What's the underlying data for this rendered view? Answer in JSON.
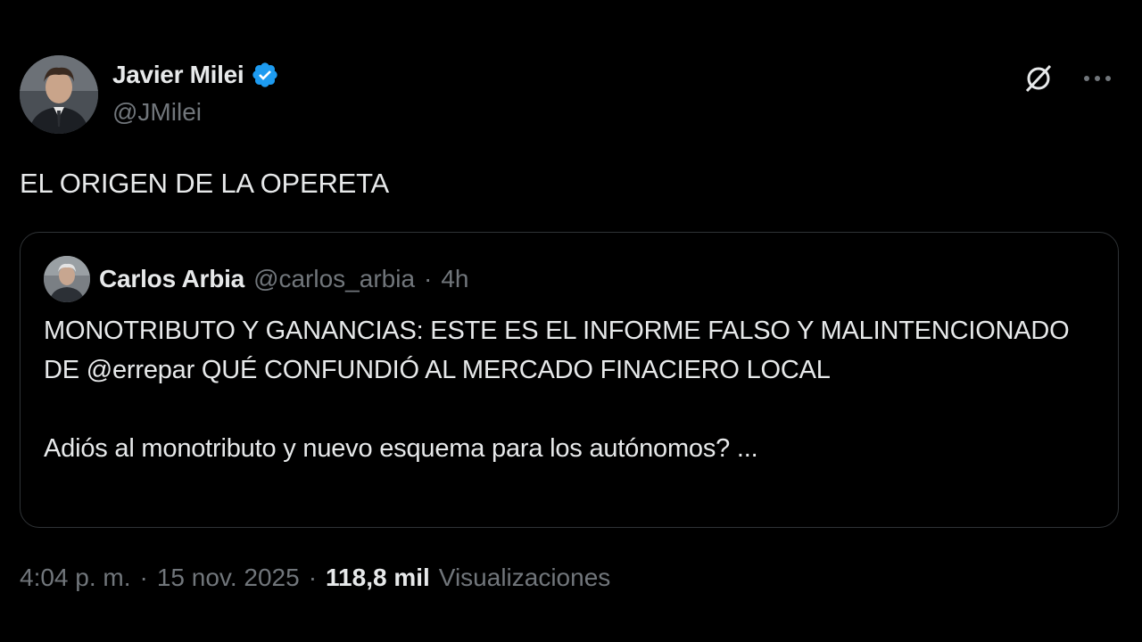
{
  "tweet": {
    "author": {
      "name": "Javier Milei",
      "handle": "@JMilei"
    },
    "text": "EL ORIGEN DE LA OPERETA",
    "quote": {
      "author": {
        "name": "Carlos Arbia",
        "handle": "@carlos_arbia"
      },
      "separator": "·",
      "time": "4h",
      "paragraph1": "MONOTRIBUTO Y GANANCIAS: ESTE ES EL INFORME FALSO Y MALINTENCIONADO DE @errepar QUÉ CONFUNDIÓ AL MERCADO FINACIERO LOCAL",
      "paragraph2": "Adiós al monotributo y nuevo esquema para los autónomos? ..."
    },
    "meta": {
      "time": "4:04 p. m.",
      "sep1": "·",
      "date": "15 nov. 2025",
      "sep2": "·",
      "views_count": "118,8 mil",
      "views_label": "Visualizaciones"
    }
  },
  "icons": {
    "verified": "verified-badge-icon",
    "grok": "grok-icon",
    "more": "more-options-icon"
  },
  "colors": {
    "verified": "#1d9bf0",
    "muted": "#71767b",
    "text": "#e7e9ea",
    "border": "#2f3336"
  }
}
